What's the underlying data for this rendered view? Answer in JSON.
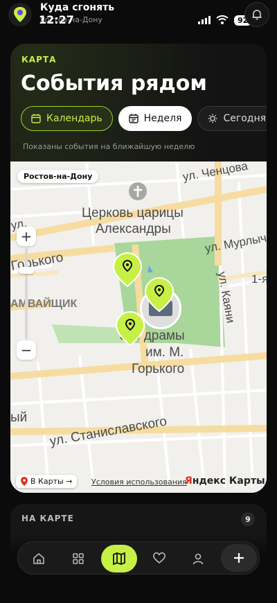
{
  "status": {
    "app_title": "Куда сгонять",
    "app_subtitle": "Ростов-на-Дону",
    "time": "12:27",
    "battery": "92"
  },
  "card": {
    "kicker": "КАРТА",
    "title": "События рядом",
    "chips": [
      {
        "label": "Календарь",
        "icon": "calendar-icon"
      },
      {
        "label": "Неделя",
        "icon": "calendar-icon"
      },
      {
        "label": "Сегодня",
        "icon": "sun-icon"
      }
    ],
    "hint": "Показаны события на ближайшую неделю"
  },
  "map": {
    "city": "Ростов-на-Дону",
    "labels": {
      "street_chentsova": "ул. Ченцова",
      "church_1": "Церковь царицы",
      "church_2": "Александры",
      "street_l": "ул.",
      "gorkogo": "Горького",
      "murlych": "ул. Мурлыч",
      "kayani": "ул. Каяни",
      "one_ya": "1-я",
      "tramvay": "АМВАЙЩИК",
      "theatre_1": "атр драмы",
      "theatre_2": "им. М.",
      "theatre_3": "Горького",
      "yy": "ый",
      "stanislav": "ул. Станиславского"
    },
    "to_maps": "В Карты →",
    "terms": "Условия использования",
    "brand_y": "Я",
    "brand_rest": "ндекс Карты"
  },
  "on_map": {
    "title": "НА КАРТЕ",
    "count": "9"
  },
  "nav": {
    "items": [
      "home-icon",
      "grid-icon",
      "map-icon",
      "heart-icon",
      "profile-icon"
    ],
    "active": "map-icon",
    "add_icon": "plus-icon"
  },
  "colors": {
    "accent": "#c6f045",
    "background": "#0b0b0b",
    "card": "#131313"
  }
}
